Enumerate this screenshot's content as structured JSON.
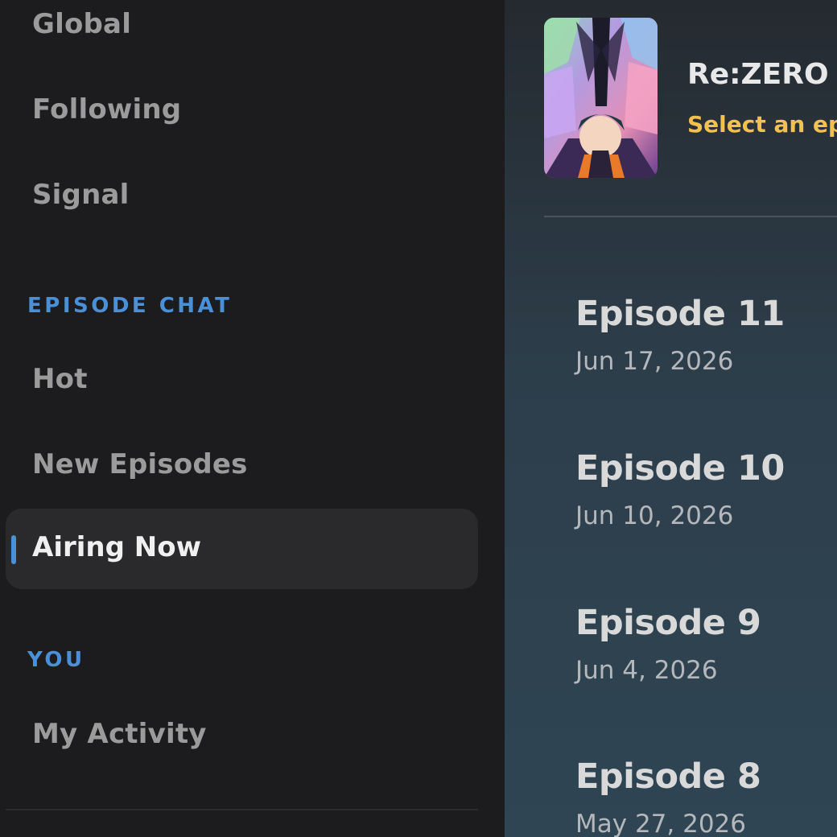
{
  "sidebar": {
    "feed_items": [
      {
        "label": "Global"
      },
      {
        "label": "Following"
      },
      {
        "label": "Signal"
      }
    ],
    "episode_chat": {
      "header": "EPISODE CHAT",
      "items": [
        {
          "label": "Hot"
        },
        {
          "label": "New Episodes"
        }
      ],
      "active_item": "Airing Now"
    },
    "you": {
      "header": "YOU",
      "items": [
        {
          "label": "My Activity"
        }
      ]
    },
    "accent_color": "#4a90d9"
  },
  "show": {
    "title": "Re:ZERO -",
    "subtitle": "Select an ep"
  },
  "episodes": [
    {
      "title": "Episode 11",
      "date": "Jun 17, 2026"
    },
    {
      "title": "Episode 10",
      "date": "Jun 10, 2026"
    },
    {
      "title": "Episode 9",
      "date": "Jun 4, 2026"
    },
    {
      "title": "Episode 8",
      "date": "May 27, 2026"
    }
  ],
  "colors": {
    "subtitle": "#f2c14e",
    "main_bg_top": "#252a30",
    "main_bg_bottom": "#2f4553"
  }
}
